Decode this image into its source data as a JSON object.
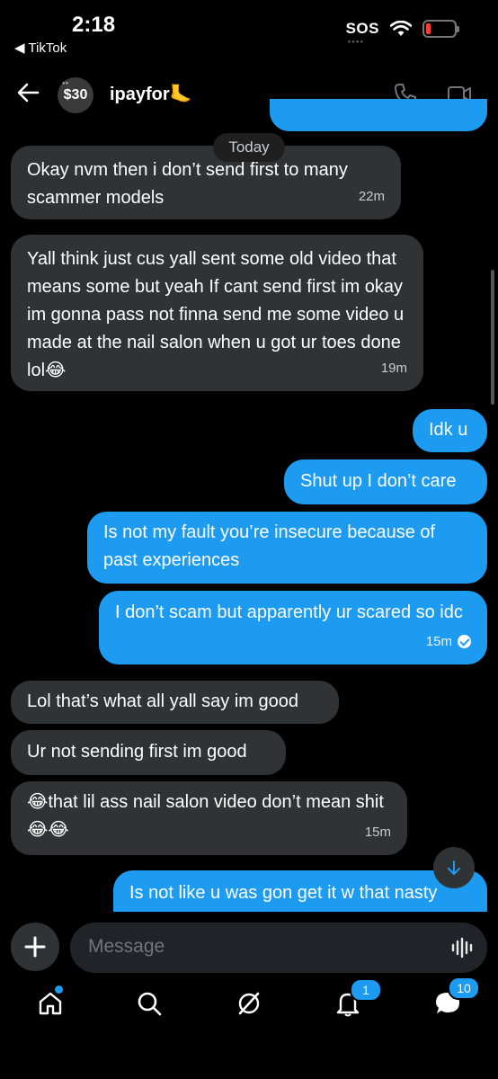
{
  "status_bar": {
    "time": "2:18",
    "back_app": "◀ TikTok",
    "sos": "SOS"
  },
  "header": {
    "avatar_text": "$30",
    "contact_name": "ipayfor🦶"
  },
  "conversation": {
    "date_divider": "Today",
    "messages": [
      {
        "direction": "in",
        "text": "Okay nvm then i don’t send first to many scammer models",
        "time": "22m"
      },
      {
        "direction": "in",
        "text": "Yall think just cus yall sent some old video that means some but yeah If cant send first im okay im gonna pass not finna send me some video u made at the nail salon when u got ur toes done lol😂",
        "time": "19m"
      },
      {
        "direction": "out",
        "text": "Idk u"
      },
      {
        "direction": "out",
        "text": "Shut up I don’t care"
      },
      {
        "direction": "out",
        "text": "Is not my fault you’re insecure because of past experiences"
      },
      {
        "direction": "out",
        "text": "I don’t scam but apparently ur scared so idc",
        "time": "15m",
        "status": "read"
      },
      {
        "direction": "in",
        "text": "Lol that’s what all yall say im good"
      },
      {
        "direction": "in",
        "text": "Ur not sending first im good"
      },
      {
        "direction": "in",
        "text": "😂that lil ass nail salon video don’t mean shit😂😂",
        "time": "15m"
      },
      {
        "direction": "out",
        "text": "Is not like u was gon get it w that nasty"
      }
    ]
  },
  "composer": {
    "placeholder": "Message"
  },
  "bottom_nav": {
    "notifications_badge": "1",
    "messages_badge": "10"
  },
  "colors": {
    "outgoing_bubble": "#1d9bf0",
    "incoming_bubble": "#2f3336",
    "background": "#000000"
  }
}
